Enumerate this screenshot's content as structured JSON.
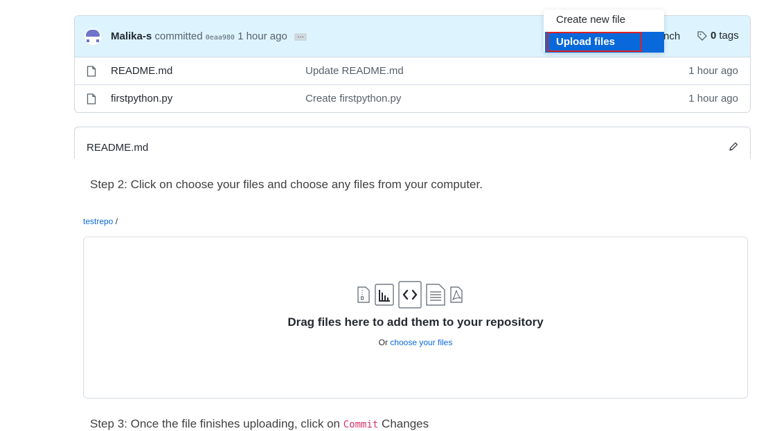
{
  "repo": {
    "commit": {
      "user": "Malika-s",
      "verb": "committed",
      "sha": "0eaa980",
      "time": "1 hour ago",
      "ellipsis": "…"
    },
    "branch_fragment": "nch",
    "tags_count": "0",
    "tags_label": "tags",
    "files": [
      {
        "name": "README.md",
        "message": "Update README.md",
        "time": "1 hour ago"
      },
      {
        "name": "firstpython.py",
        "message": "Create firstpython.py",
        "time": "1 hour ago"
      }
    ]
  },
  "dropdown": {
    "items": [
      "Create new file",
      "Upload files"
    ],
    "selected": "Upload files"
  },
  "readme": {
    "title": "README.md"
  },
  "steps": {
    "step2": "Step 2: Click on choose your files and choose any files from your computer.",
    "step3_prefix": "Step 3: Once the file finishes uploading, click on",
    "step3_code": "Commit",
    "step3_suffix": "Changes"
  },
  "upload": {
    "breadcrumb_repo": "testrepo",
    "breadcrumb_sep": "/",
    "title": "Drag files here to add them to your repository",
    "or_text": "Or",
    "choose_link": "choose your files"
  },
  "colors": {
    "link": "#0969da",
    "header_bg": "#ddf4ff",
    "highlight": "#0969da",
    "annotation_red": "#e02020"
  }
}
